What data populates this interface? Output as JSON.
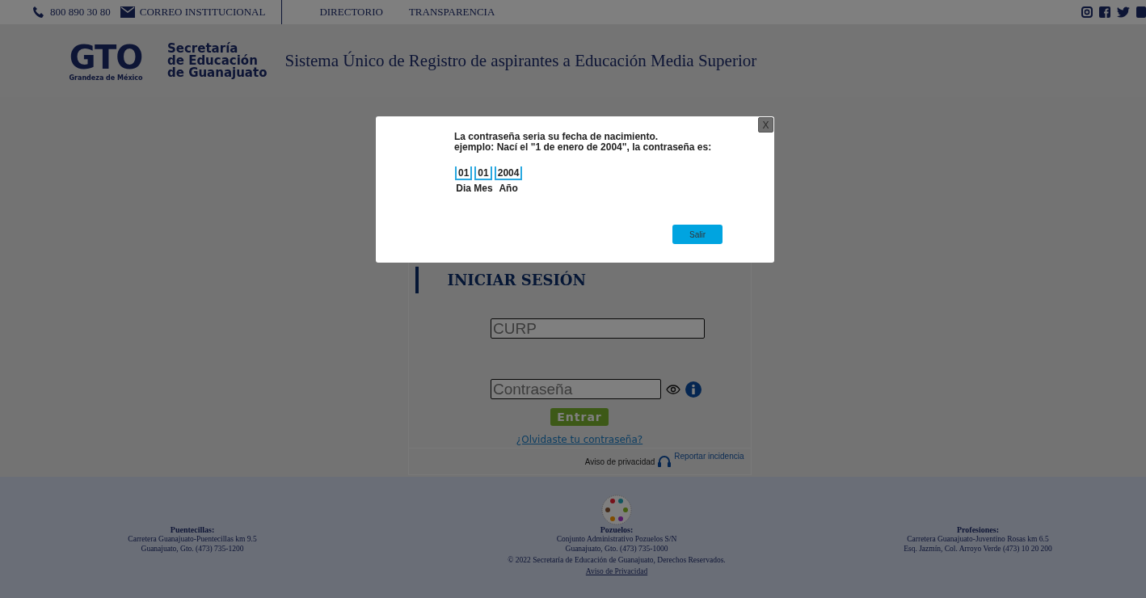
{
  "top_bar": {
    "phone": "800 890 30 80",
    "email": "CORREO INSTITUCIONAL",
    "links": [
      "DIRECTORIO",
      "TRANSPARENCIA"
    ]
  },
  "header": {
    "logo_text": "GTO",
    "logo_tagline": "Grandeza de México",
    "agency_lines": [
      "Secretaría",
      "de Educación",
      "de Guanajuato"
    ],
    "title": "Sistema Único de Registro de aspirantes a Educación Media Superior"
  },
  "login": {
    "heading": "INICIAR SESIÓN",
    "curp_placeholder": "CURP",
    "password_placeholder": "Contraseña",
    "submit": "Entrar",
    "forgot_link": "¿Olvidaste tu contraseña?",
    "privacy_link": "Aviso de privacidad",
    "report_link": "Reportar incidencia"
  },
  "footer": {
    "locations": [
      {
        "name": "Puentecillas:",
        "lines": [
          "Carretera Guanajuato-Puentecillas km 9.5",
          "Guanajuato, Gto. (473) 735-1200"
        ]
      },
      {
        "name": "Pozuelos:",
        "lines": [
          "Conjunto Administrativo Pozuelos S/N",
          "Guanajuato, Gto. (473) 735-1000"
        ]
      },
      {
        "name": "Profesiones:",
        "lines": [
          "Carretera Guanajuato-Juventino Rosas km 6.5",
          "Esq. Jazmín, Col. Arroyo Verde (473) 10 20 200"
        ]
      }
    ],
    "copyright": "© 2022 Secretaría de Educación de Guanajuato, Derechos Reservados.",
    "privacy_link": "Aviso de Privacidad"
  },
  "modal": {
    "close": "X",
    "lines": [
      "La contraseña seria su fecha de nacimiento.",
      "ejemplo: Nací el \"1 de enero de 2004\", la contraseña es:"
    ],
    "example": [
      {
        "value": "01",
        "label": "Dia"
      },
      {
        "value": "01",
        "label": "Mes"
      },
      {
        "value": "2004",
        "label": "Año"
      }
    ],
    "button": "Salir"
  }
}
